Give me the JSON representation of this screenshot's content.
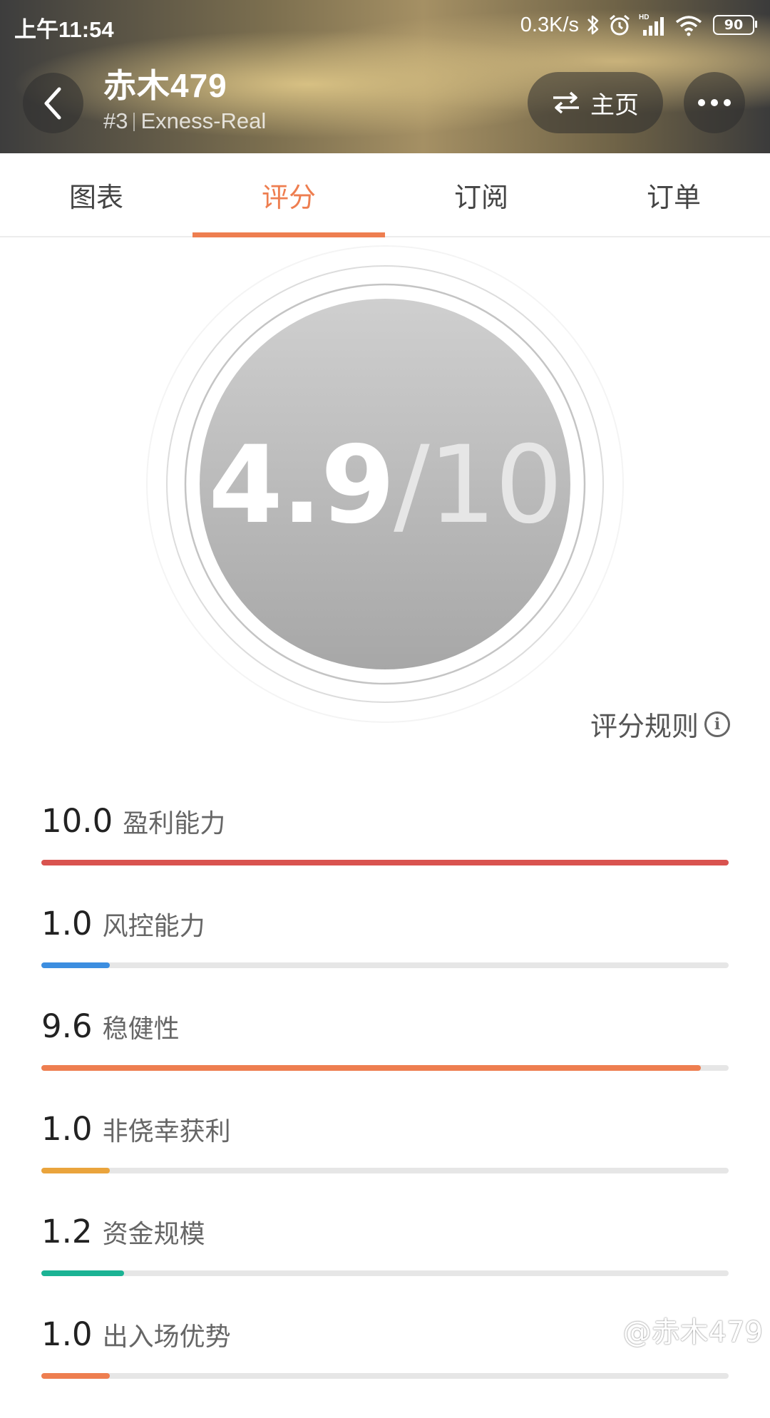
{
  "status_bar": {
    "time": "上午11:54",
    "net_speed": "0.3K/s",
    "battery": "90",
    "icons": [
      "bluetooth-icon",
      "alarm-icon",
      "signal-icon",
      "wifi-icon",
      "battery-icon"
    ]
  },
  "header": {
    "trader_name": "赤木479",
    "rank": "#3",
    "server": "Exness-Real",
    "home_label": "主页"
  },
  "tabs": [
    {
      "label": "图表",
      "active": false
    },
    {
      "label": "评分",
      "active": true
    },
    {
      "label": "订阅",
      "active": false
    },
    {
      "label": "订单",
      "active": false
    }
  ],
  "score": {
    "value": "4.9",
    "total": "/10"
  },
  "rules_label": "评分规则",
  "metrics": [
    {
      "value": "10.0",
      "label": "盈利能力",
      "score": 10.0,
      "color": "#d9534f"
    },
    {
      "value": "1.0",
      "label": "风控能力",
      "score": 1.0,
      "color": "#3c8ee0"
    },
    {
      "value": "9.6",
      "label": "稳健性",
      "score": 9.6,
      "color": "#ee7e50"
    },
    {
      "value": "1.0",
      "label": "非侥幸获利",
      "score": 1.0,
      "color": "#eaa43c"
    },
    {
      "value": "1.2",
      "label": "资金规模",
      "score": 1.2,
      "color": "#1bb394"
    },
    {
      "value": "1.0",
      "label": "出入场优势",
      "score": 1.0,
      "color": "#ee7e50"
    }
  ],
  "watermark": "@赤木479",
  "colors": {
    "accent": "#ee7e50"
  }
}
